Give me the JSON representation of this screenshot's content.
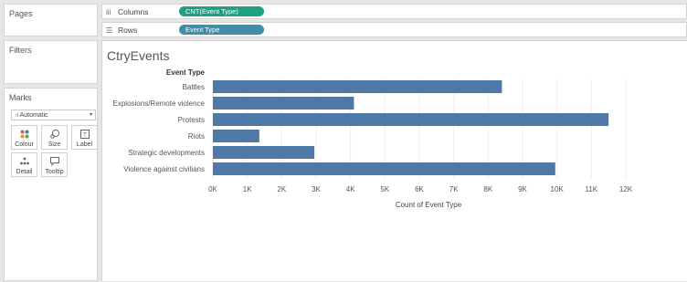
{
  "panes": {
    "pages_title": "Pages",
    "filters_title": "Filters",
    "marks_title": "Marks"
  },
  "marks": {
    "mark_type": "Automatic",
    "buttons": [
      {
        "label": "Colour",
        "icon": "colour-icon"
      },
      {
        "label": "Size",
        "icon": "size-icon"
      },
      {
        "label": "Label",
        "icon": "label-icon"
      },
      {
        "label": "Detail",
        "icon": "detail-icon"
      },
      {
        "label": "Tooltip",
        "icon": "tooltip-icon"
      }
    ]
  },
  "shelves": {
    "columns_label": "Columns",
    "columns_pill": "CNT(Event Type)",
    "rows_label": "Rows",
    "rows_pill": "Event Type"
  },
  "viz": {
    "title": "CtryEvents"
  },
  "colors": {
    "bar": "#4e79a7",
    "columns_pill": "#1fa07f",
    "rows_pill": "#3f8fa6"
  },
  "chart_data": {
    "type": "bar",
    "orientation": "horizontal",
    "row_header": "Event Type",
    "categories": [
      "Battles",
      "Explosions/Remote violence",
      "Protests",
      "Riots",
      "Strategic developments",
      "Violence against civilians"
    ],
    "values": [
      8400,
      4100,
      11500,
      1350,
      2950,
      9950
    ],
    "xlabel": "Count of Event Type",
    "xlim": [
      0,
      12000
    ],
    "ticks": [
      0,
      1000,
      2000,
      3000,
      4000,
      5000,
      6000,
      7000,
      8000,
      9000,
      10000,
      11000,
      12000
    ],
    "tick_labels": [
      "0K",
      "1K",
      "2K",
      "3K",
      "4K",
      "5K",
      "6K",
      "7K",
      "8K",
      "9K",
      "10K",
      "11K",
      "12K"
    ],
    "grid": true
  }
}
